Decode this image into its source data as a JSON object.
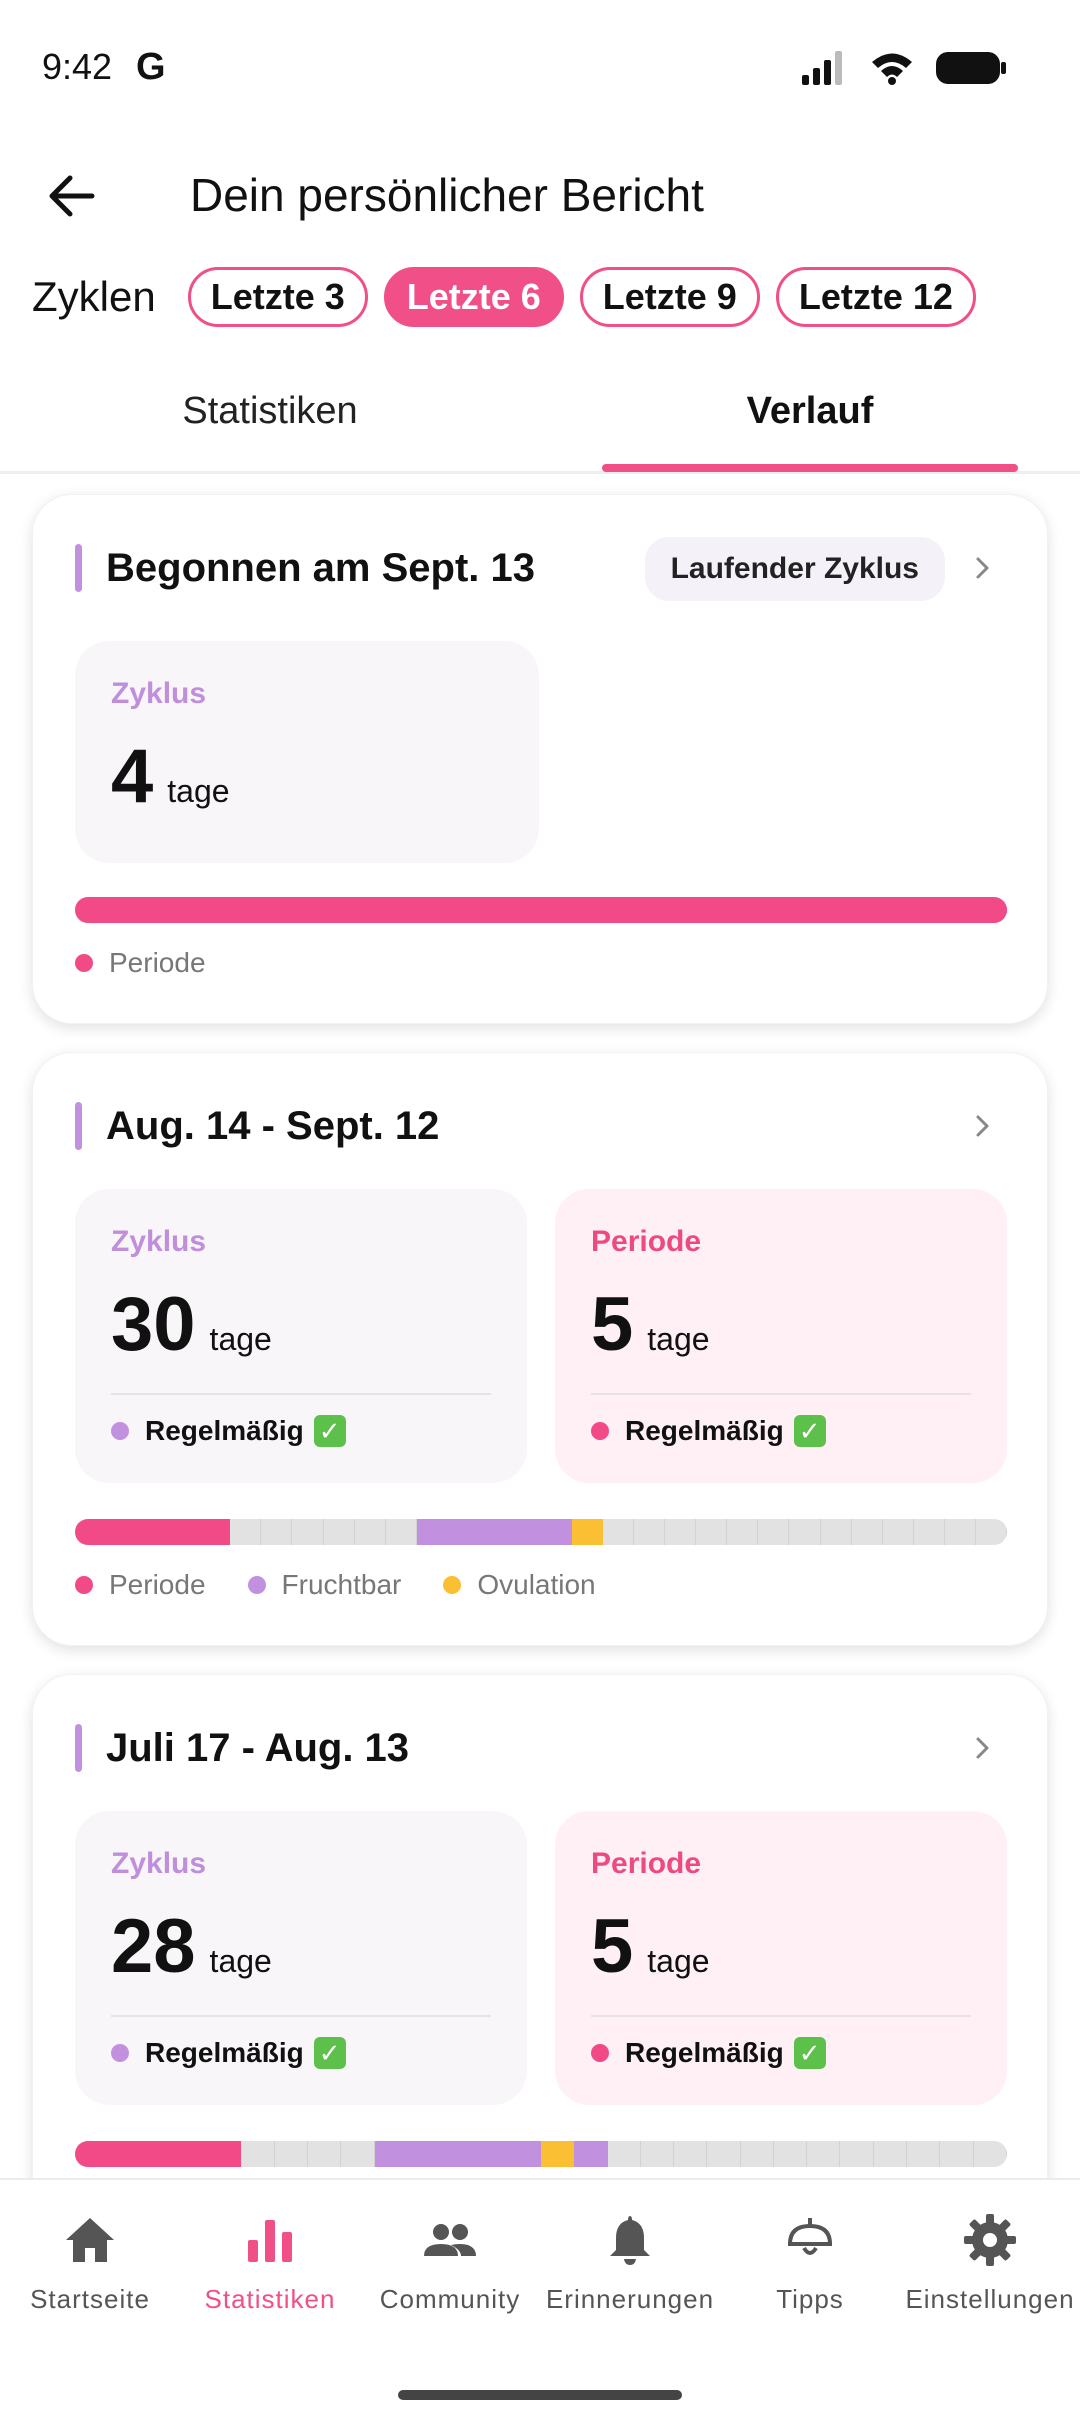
{
  "status": {
    "time": "9:42",
    "g_label": "G"
  },
  "header": {
    "title": "Dein persönlicher Bericht"
  },
  "cycles": {
    "label": "Zyklen",
    "options": [
      "Letzte 3",
      "Letzte 6",
      "Letzte 9",
      "Letzte 12"
    ],
    "selected": "Letzte 6"
  },
  "tabs": {
    "stats": "Statistiken",
    "history": "Verlauf",
    "active": "history"
  },
  "cards": [
    {
      "title": "Begonnen am Sept. 13",
      "badge": "Laufender Zyklus",
      "cycle": {
        "label": "Zyklus",
        "value": "4",
        "unit": "tage"
      },
      "timeline": {
        "total_days": 4,
        "period_days": [
          1,
          4
        ]
      },
      "legend": {
        "period": "Periode"
      }
    },
    {
      "title": "Aug. 14 - Sept. 12",
      "cycle": {
        "label": "Zyklus",
        "value": "30",
        "unit": "tage",
        "status": "Regelmäßig"
      },
      "period": {
        "label": "Periode",
        "value": "5",
        "unit": "tage",
        "status": "Regelmäßig"
      },
      "timeline": {
        "total_days": 30,
        "period_days": [
          1,
          5
        ],
        "fertile_days": [
          12,
          17
        ],
        "ovulation_day": 17
      },
      "legend": {
        "period": "Periode",
        "fertile": "Fruchtbar",
        "ovulation": "Ovulation"
      }
    },
    {
      "title": "Juli 17 - Aug. 13",
      "cycle": {
        "label": "Zyklus",
        "value": "28",
        "unit": "tage",
        "status": "Regelmäßig"
      },
      "period": {
        "label": "Periode",
        "value": "5",
        "unit": "tage",
        "status": "Regelmäßig"
      },
      "timeline": {
        "total_days": 28,
        "period_days": [
          1,
          5
        ],
        "fertile_days": [
          10,
          16
        ],
        "ovulation_day": 15
      }
    }
  ],
  "colors": {
    "accent": "#f04f87",
    "period": "#f24a87",
    "fertile": "#c191e0",
    "ovulation": "#fbbf33",
    "check": "#5cc04a"
  },
  "nav": {
    "items": [
      {
        "label": "Startseite",
        "icon": "home-icon"
      },
      {
        "label": "Statistiken",
        "icon": "bar-chart-icon"
      },
      {
        "label": "Community",
        "icon": "people-icon"
      },
      {
        "label": "Erinnerungen",
        "icon": "bell-icon"
      },
      {
        "label": "Tipps",
        "icon": "lamp-icon"
      },
      {
        "label": "Einstellungen",
        "icon": "gear-icon"
      }
    ],
    "active": "Statistiken"
  }
}
